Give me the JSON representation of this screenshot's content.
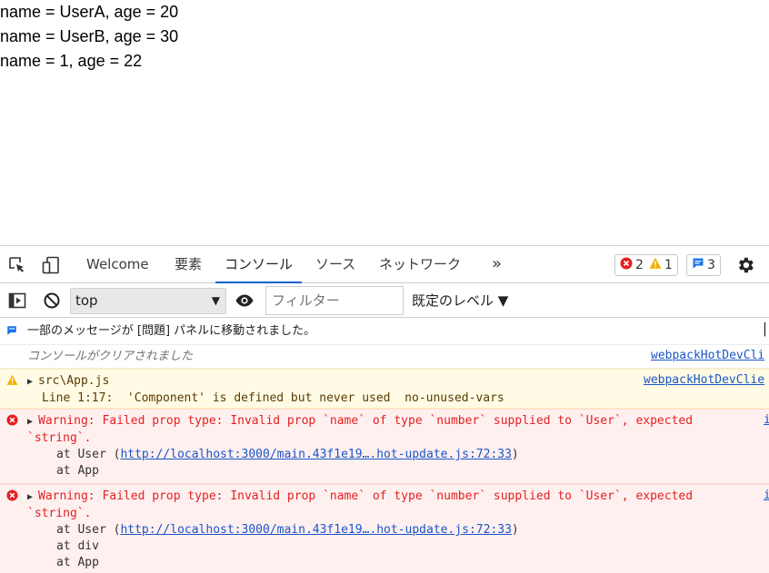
{
  "page": {
    "lines": [
      "name = UserA, age = 20",
      "name = UserB, age = 30",
      "name = 1, age = 22"
    ]
  },
  "devtools": {
    "tabs": [
      {
        "label": "Welcome",
        "active": false
      },
      {
        "label": "要素",
        "active": false
      },
      {
        "label": "コンソール",
        "active": true
      },
      {
        "label": "ソース",
        "active": false
      },
      {
        "label": "ネットワーク",
        "active": false
      }
    ],
    "more_label": "»",
    "counts": {
      "errors": "2",
      "warnings": "1",
      "messages": "3"
    },
    "filterbar": {
      "context": "top",
      "filter_placeholder": "フィルター",
      "levels": "既定のレベル ▼"
    },
    "console": {
      "info_moved": "一部のメッセージが [問題] パネルに移動されました。",
      "cleared": "コンソールがクリアされました",
      "cleared_source": "webpackHotDevCli",
      "warning": {
        "file": "src\\App.js",
        "detail": "Line 1:17:  'Component' is defined but never used  no-unused-vars",
        "source": "webpackHotDevClie"
      },
      "errors": [
        {
          "line1": "Warning: Failed prop type: Invalid prop `name` of type `number` supplied to `User`, expected",
          "line2": "`string`.",
          "at_prefix": "at User (",
          "link": "http://localhost:3000/main.43f1e19….hot-update.js:72:33",
          "at_suffix": ")",
          "stack": [
            "at App"
          ],
          "source": "i"
        },
        {
          "line1": "Warning: Failed prop type: Invalid prop `name` of type `number` supplied to `User`, expected",
          "line2": "`string`.",
          "at_prefix": "at User (",
          "link": "http://localhost:3000/main.43f1e19….hot-update.js:72:33",
          "at_suffix": ")",
          "stack": [
            "at div",
            "at App"
          ],
          "source": "i"
        }
      ]
    }
  },
  "colors": {
    "accent": "#0a61cc",
    "error": "#e41f1f",
    "warning_bg": "#fffbe5",
    "error_bg": "#fff0f0",
    "link": "#1a55c6"
  }
}
